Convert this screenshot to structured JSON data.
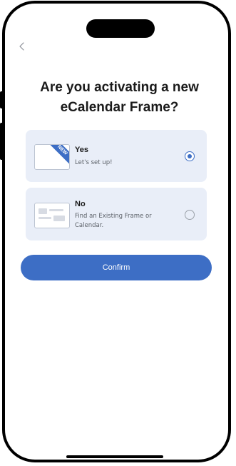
{
  "heading": {
    "line1": "Are you activating a new",
    "line2": "eCalendar Frame?"
  },
  "nav": {
    "back_icon": "chevron-left-icon"
  },
  "options": [
    {
      "title": "Yes",
      "subtitle": "Let's set up!",
      "badge": "NEW",
      "selected": true
    },
    {
      "title": "No",
      "subtitle": "Find an Existing Frame or Calendar.",
      "selected": false
    }
  ],
  "confirm": {
    "label": "Confirm"
  },
  "colors": {
    "accent": "#3d6ec5",
    "card_background": "#e9eef8"
  }
}
